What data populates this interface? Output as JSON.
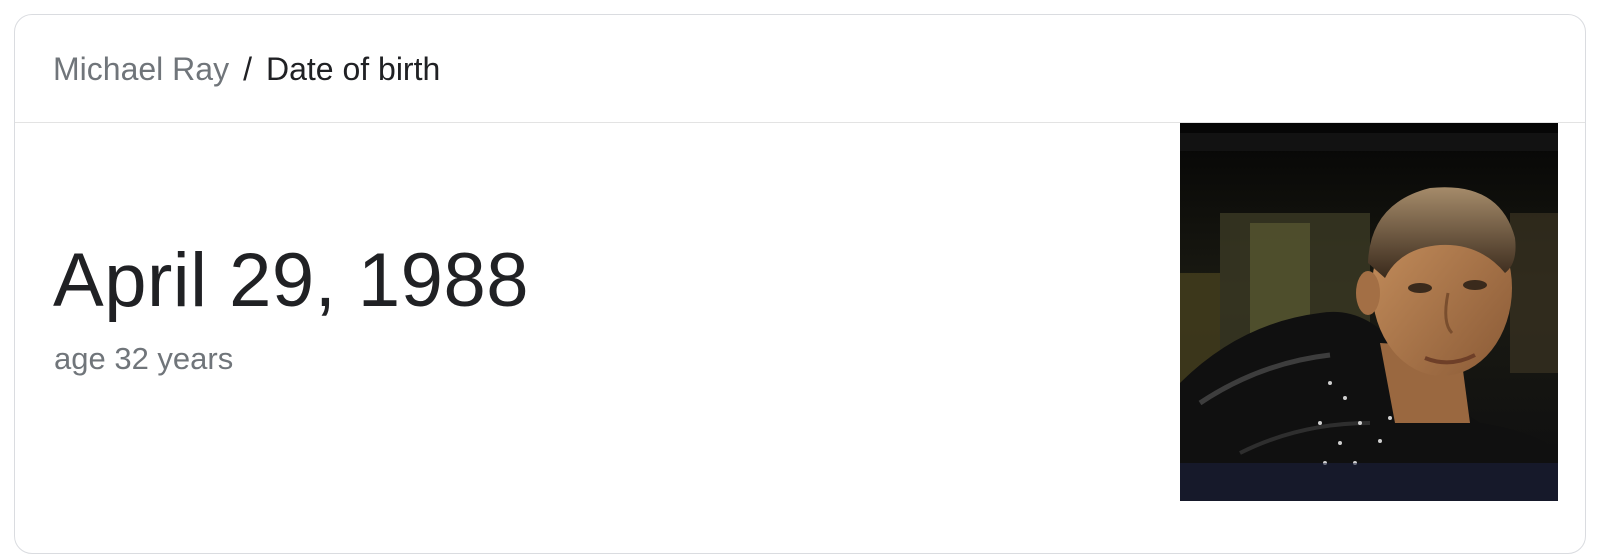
{
  "breadcrumb": {
    "entity": "Michael Ray",
    "separator": "/",
    "attribute": "Date of birth"
  },
  "answer": {
    "date": "April 29, 1988",
    "age": "age 32 years"
  },
  "photo": {
    "icon": "person-photo"
  }
}
